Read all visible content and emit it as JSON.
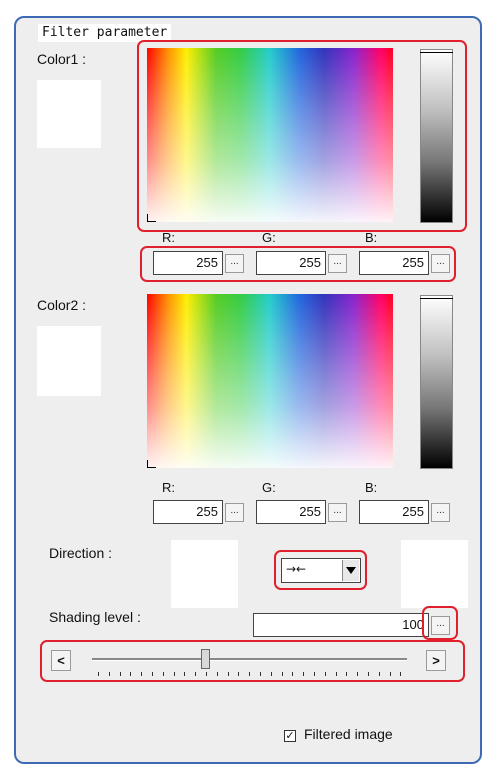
{
  "panel": {
    "title": "Filter parameter"
  },
  "color1": {
    "label": "Color1 :",
    "r_label": "R:",
    "g_label": "G:",
    "b_label": "B:",
    "r_value": "255",
    "g_value": "255",
    "b_value": "255"
  },
  "color2": {
    "label": "Color2 :",
    "r_label": "R:",
    "g_label": "G:",
    "b_label": "B:",
    "r_value": "255",
    "g_value": "255",
    "b_value": "255"
  },
  "ellipsis": "...",
  "direction": {
    "label": "Direction :",
    "selected_icon": "arrows-inward-icon",
    "selected_glyph": "→←"
  },
  "shading": {
    "label": "Shading level :",
    "value": "100",
    "slider_level_percent": 36
  },
  "slider": {
    "left_button": "<",
    "right_button": ">"
  },
  "filtered_image": {
    "label": "Filtered image",
    "checked": true,
    "check_glyph": "✓"
  },
  "colors": {
    "highlight": "#e0202c",
    "panel_border": "#3d6ab3",
    "panel_bg": "#eeeeee"
  }
}
